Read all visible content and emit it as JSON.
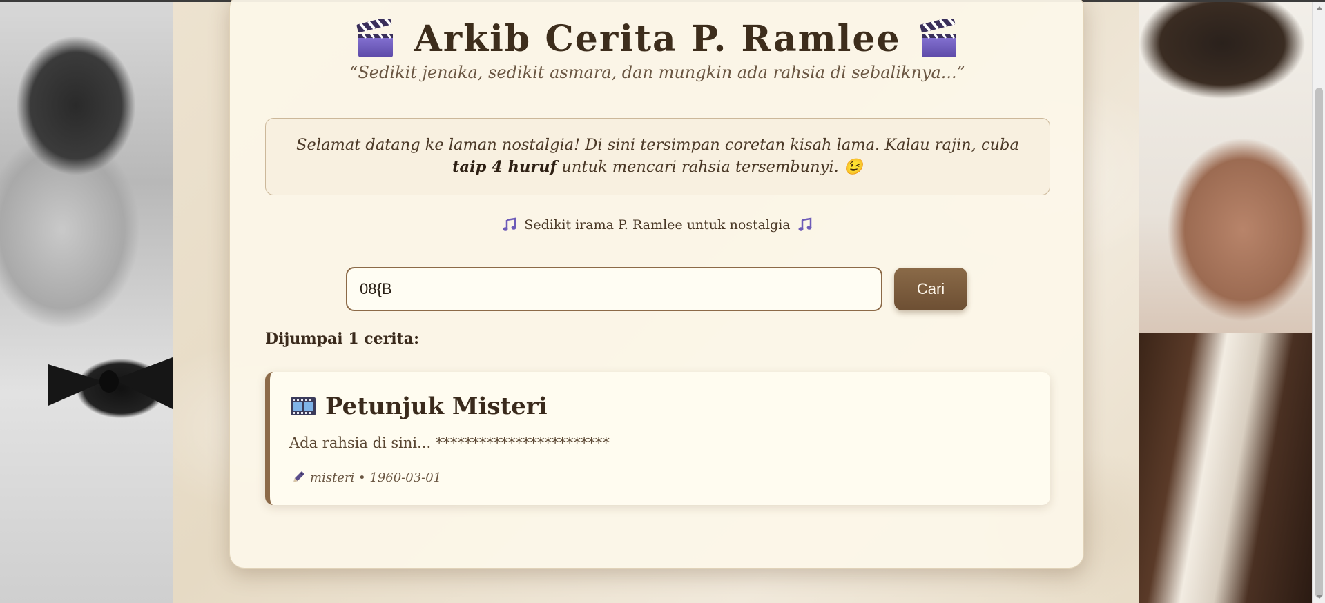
{
  "header": {
    "title": "Arkib Cerita P. Ramlee",
    "tagline": "“Sedikit jenaka, sedikit asmara, dan mungkin ada rahsia di sebaliknya...”",
    "left_icon": "clapperboard-icon",
    "right_icon": "clapperboard-icon"
  },
  "welcome": {
    "text_before": "Selamat datang ke laman nostalgia! Di sini tersimpan coretan kisah lama. Kalau rajin, cuba ",
    "bold_text": "taip 4 huruf",
    "text_after": " untuk mencari rahsia tersembunyi.",
    "emoji": "😉"
  },
  "music": {
    "label": "Sedikit irama P. Ramlee untuk nostalgia",
    "icon": "music-notes-icon"
  },
  "search": {
    "value": "08{B",
    "button_label": "Cari"
  },
  "results": {
    "count_label": "Dijumpai 1 cerita:",
    "items": [
      {
        "icon": "film-frames-icon",
        "title": "Petunjuk Misteri",
        "excerpt": "Ada rahsia di sini... ************************",
        "meta_icon": "pen-icon",
        "meta": "misteri • 1960-03-01"
      }
    ]
  },
  "colors": {
    "accent": "#8c6a48",
    "card_bg": "#fcf6e9",
    "text_dark": "#3a2a1c"
  }
}
